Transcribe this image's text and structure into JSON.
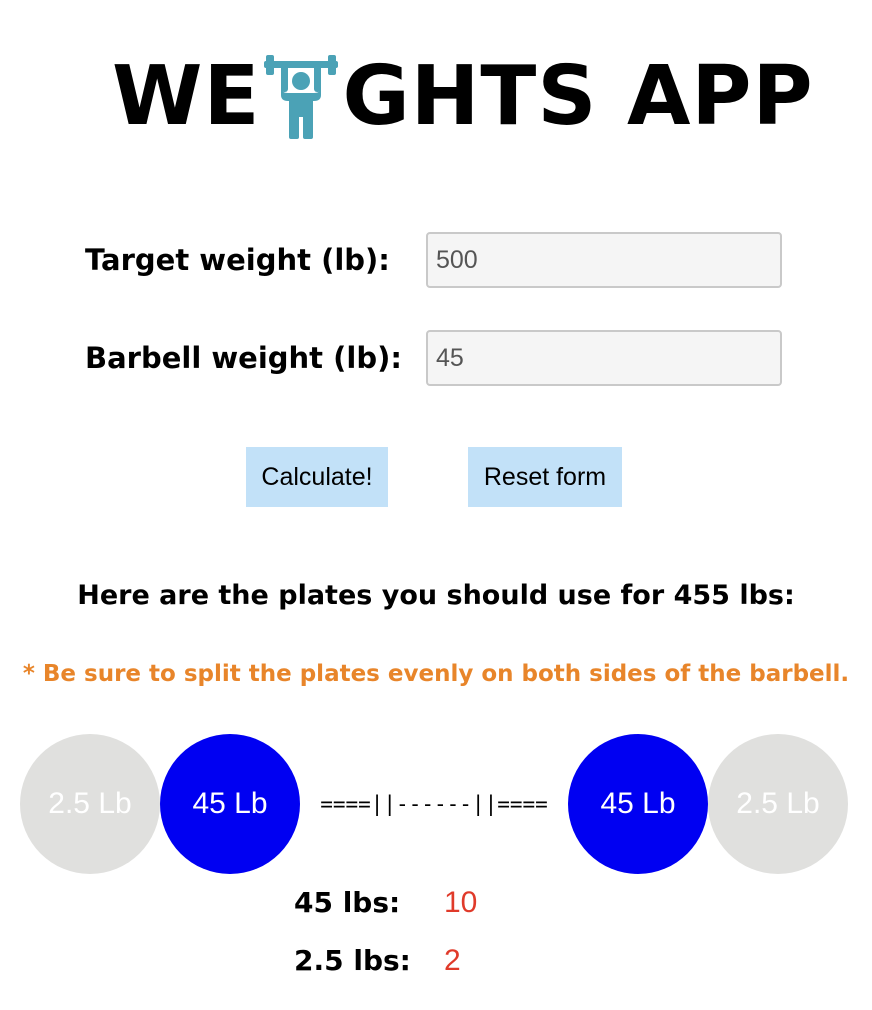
{
  "title": {
    "prefix": "WE",
    "suffix": "GHTS APP",
    "icon": "weightlifter-icon",
    "icon_color": "#4ba2b6"
  },
  "form": {
    "target_label": "Target weight (lb):",
    "target_value": "500",
    "barbell_label": "Barbell weight (lb):",
    "barbell_value": "45"
  },
  "buttons": {
    "calculate": "Calculate!",
    "reset": "Reset form",
    "color": "#c2e1f8"
  },
  "result": {
    "heading": "Here are the plates you should use for 455 lbs:",
    "note": "* Be sure to split the plates evenly on both sides of the barbell.",
    "note_color": "#e8852a"
  },
  "barbell": {
    "left_plates": [
      {
        "label": "2.5 Lb",
        "color": "#e0e0de"
      },
      {
        "label": "45 Lb",
        "color": "#0000f2"
      }
    ],
    "bar": "====||------||====",
    "right_plates": [
      {
        "label": "45 Lb",
        "color": "#0000f2"
      },
      {
        "label": "2.5 Lb",
        "color": "#e0e0de"
      }
    ]
  },
  "counts": [
    {
      "label": "45 lbs:",
      "value": "10"
    },
    {
      "label": "2.5 lbs:",
      "value": "2"
    }
  ],
  "count_value_color": "#e03a2a"
}
